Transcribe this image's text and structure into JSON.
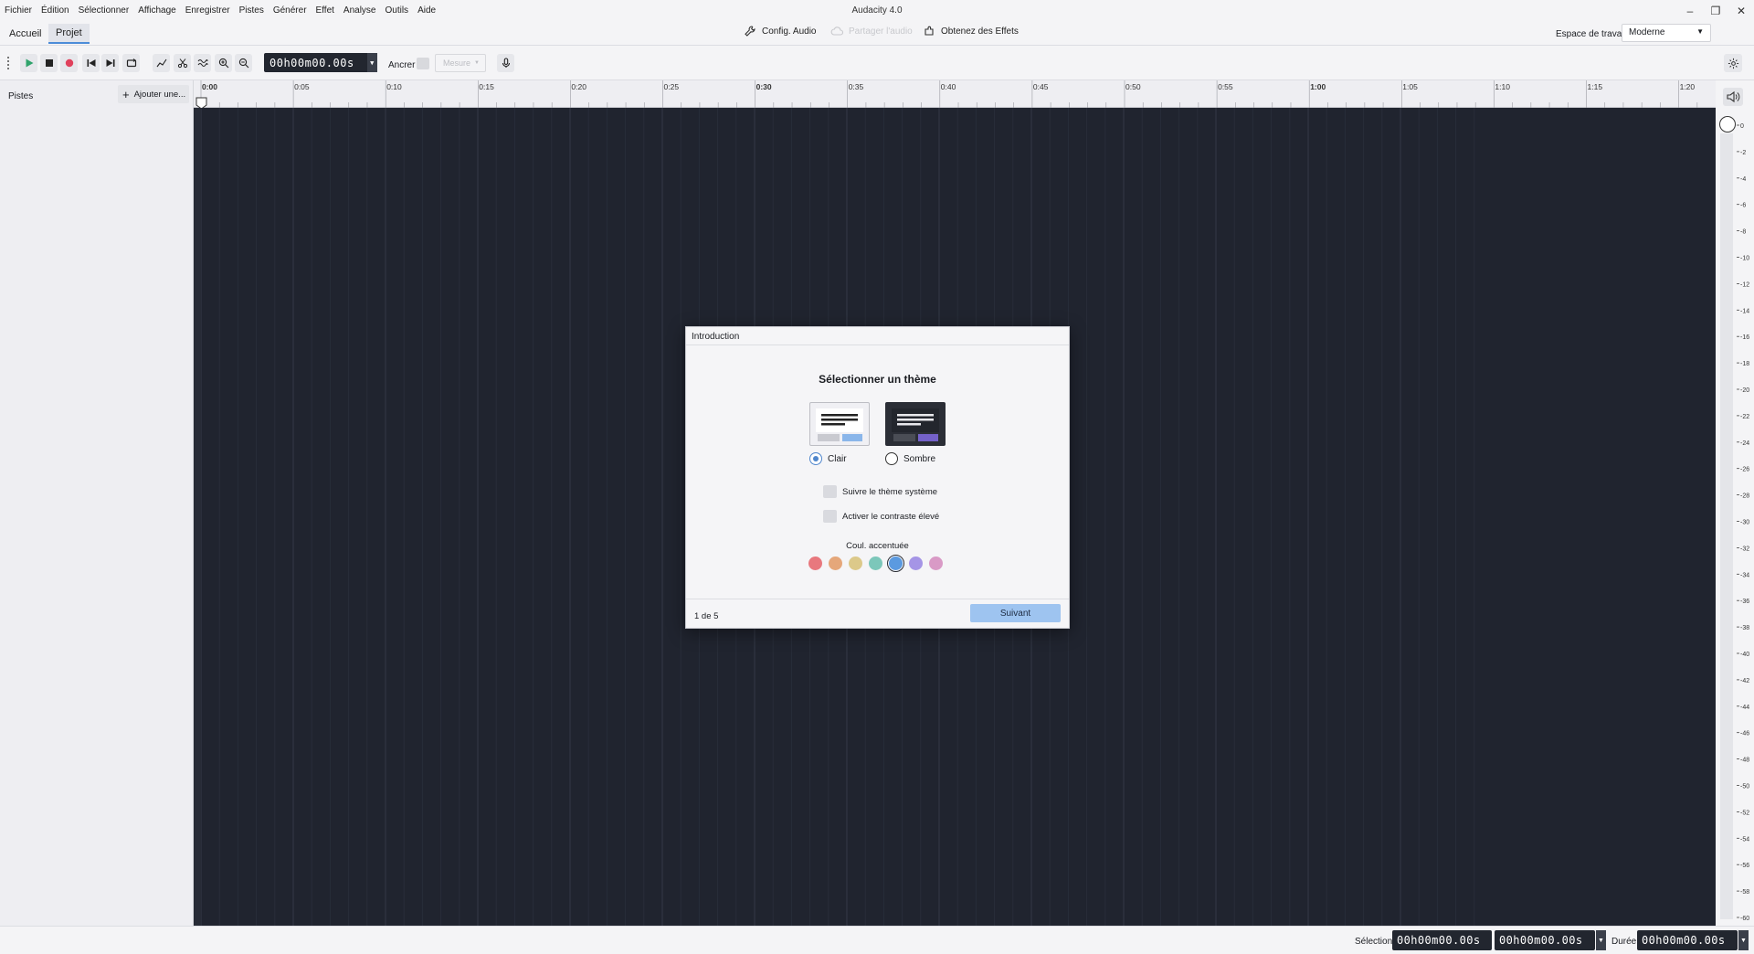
{
  "app": {
    "title": "Audacity 4.0"
  },
  "menu": [
    "Fichier",
    "Édition",
    "Sélectionner",
    "Affichage",
    "Enregistrer",
    "Pistes",
    "Générer",
    "Effet",
    "Analyse",
    "Outils",
    "Aide"
  ],
  "tabs": {
    "home": "Accueil",
    "project": "Projet"
  },
  "topbar": {
    "audio_setup": "Config. Audio",
    "share_audio": "Partager l'audio",
    "get_effects": "Obtenez des Effets",
    "workspace_label": "Espace de travail",
    "workspace_value": "Moderne"
  },
  "toolbar": {
    "time": "00h00m00.00s",
    "snap_label": "Ancrer",
    "snap_value": "Mesure"
  },
  "tracks": {
    "header": "Pistes",
    "add_button": "Ajouter une..."
  },
  "ruler": {
    "labels": [
      "0:00",
      "0:05",
      "0:10",
      "0:15",
      "0:20",
      "0:25",
      "0:30",
      "0:35",
      "0:40",
      "0:45",
      "0:50",
      "0:55",
      "1:00",
      "1:05",
      "1:10",
      "1:15",
      "1:20"
    ],
    "bold_labels": [
      "0:00",
      "0:30",
      "1:00"
    ]
  },
  "meter": {
    "scale": [
      "0",
      "-2",
      "-4",
      "-6",
      "-8",
      "-10",
      "-12",
      "-14",
      "-16",
      "-18",
      "-20",
      "-22",
      "-24",
      "-26",
      "-28",
      "-30",
      "-32",
      "-34",
      "-36",
      "-38",
      "-40",
      "-42",
      "-44",
      "-46",
      "-48",
      "-50",
      "-52",
      "-54",
      "-56",
      "-58",
      "-60"
    ]
  },
  "status": {
    "selection_label": "Sélection",
    "selection_start": "00h00m00.00s",
    "selection_end": "00h00m00.00s",
    "duration_label": "Durée",
    "duration": "00h00m00.00s"
  },
  "dialog": {
    "header": "Introduction",
    "title": "Sélectionner un thème",
    "themes": {
      "light": "Clair",
      "dark": "Sombre",
      "selected": "light"
    },
    "follow_system": "Suivre le thème système",
    "high_contrast": "Activer le contraste élevé",
    "accent_label": "Coul. accentuée",
    "accent_colors": [
      "#e8787e",
      "#e5a77a",
      "#dcc98a",
      "#7cc7ba",
      "#5b9ae0",
      "#a595e6",
      "#d99ac6"
    ],
    "accent_selected": 4,
    "page": "1 de 5",
    "next_button": "Suivant"
  },
  "colors": {
    "canvas": "#20242f",
    "accent": "#4f86cc",
    "next_button": "#9ec4f0"
  }
}
